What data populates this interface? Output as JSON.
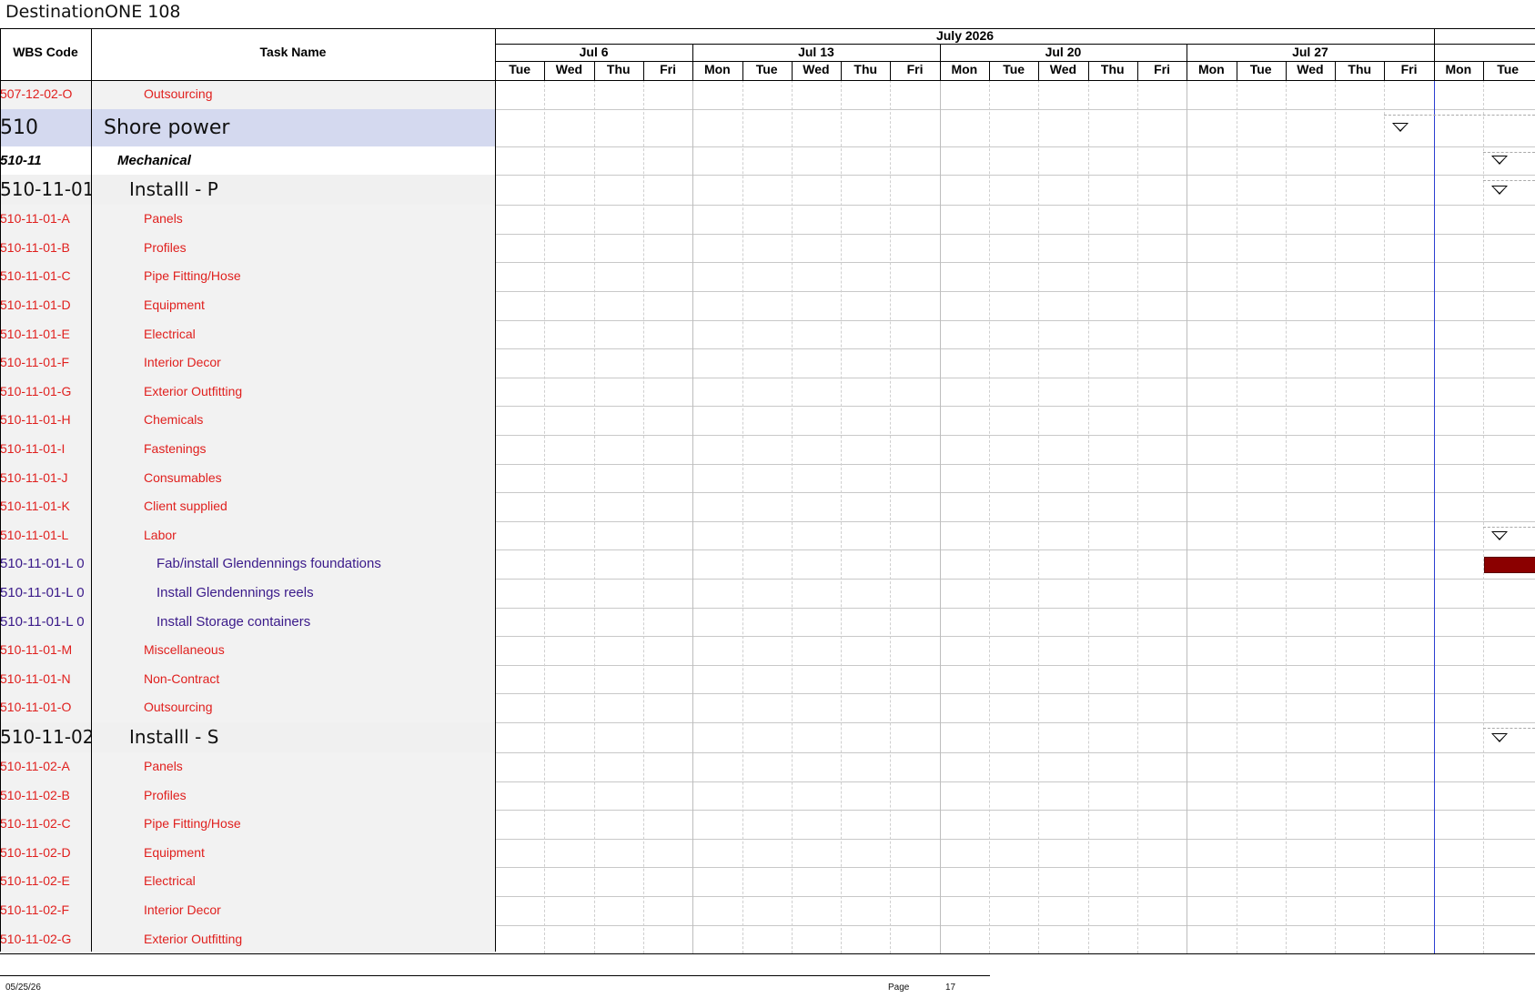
{
  "document": {
    "title": "DestinationONE 108"
  },
  "columns": {
    "wbs_header": "WBS Code",
    "task_header": "Task Name"
  },
  "timeline": {
    "month": "July 2026",
    "weeks": [
      "Jul 6",
      "Jul 13",
      "Jul 20",
      "Jul 27"
    ],
    "days": [
      "Tue",
      "Wed",
      "Thu",
      "Fri",
      "Mon",
      "Tue",
      "Wed",
      "Thu",
      "Fri",
      "Mon",
      "Tue",
      "Wed",
      "Thu",
      "Fri",
      "Mon",
      "Tue",
      "Wed",
      "Thu",
      "Fri",
      "Mon",
      "Tue"
    ]
  },
  "rows": [
    {
      "wbs": "507-12-02-O",
      "name": "Outsourcing",
      "style": "leaf"
    },
    {
      "wbs": "510",
      "name": "Shore power",
      "style": "level1",
      "summary_marker_day": 18
    },
    {
      "wbs": "510-11",
      "name": "Mechanical",
      "style": "level2",
      "summary_marker_day": 20
    },
    {
      "wbs": "510-11-01",
      "name": "Installl - P",
      "style": "level3",
      "summary_marker_day": 20
    },
    {
      "wbs": "510-11-01-A",
      "name": "Panels",
      "style": "leaf"
    },
    {
      "wbs": "510-11-01-B",
      "name": "Profiles",
      "style": "leaf"
    },
    {
      "wbs": "510-11-01-C",
      "name": "Pipe Fitting/Hose",
      "style": "leaf"
    },
    {
      "wbs": "510-11-01-D",
      "name": "Equipment",
      "style": "leaf"
    },
    {
      "wbs": "510-11-01-E",
      "name": "Electrical",
      "style": "leaf"
    },
    {
      "wbs": "510-11-01-F",
      "name": "Interior Decor",
      "style": "leaf"
    },
    {
      "wbs": "510-11-01-G",
      "name": "Exterior Outfitting",
      "style": "leaf"
    },
    {
      "wbs": "510-11-01-H",
      "name": "Chemicals",
      "style": "leaf"
    },
    {
      "wbs": "510-11-01-I",
      "name": "Fastenings",
      "style": "leaf"
    },
    {
      "wbs": "510-11-01-J",
      "name": "Consumables",
      "style": "leaf"
    },
    {
      "wbs": "510-11-01-K",
      "name": "Client supplied",
      "style": "leaf"
    },
    {
      "wbs": "510-11-01-L",
      "name": "Labor",
      "style": "leaf",
      "summary_marker_day": 20
    },
    {
      "wbs": "510-11-01-L 0",
      "name": "Fab/install Glendennings foundations",
      "style": "task",
      "bar_start_day": 20
    },
    {
      "wbs": "510-11-01-L 0",
      "name": "Install Glendennings reels",
      "style": "task"
    },
    {
      "wbs": "510-11-01-L 0",
      "name": "Install Storage containers",
      "style": "task"
    },
    {
      "wbs": "510-11-01-M",
      "name": "Miscellaneous",
      "style": "leaf"
    },
    {
      "wbs": "510-11-01-N",
      "name": "Non-Contract",
      "style": "leaf"
    },
    {
      "wbs": "510-11-01-O",
      "name": "Outsourcing",
      "style": "leaf"
    },
    {
      "wbs": "510-11-02",
      "name": "Installl - S",
      "style": "level3",
      "summary_marker_day": 20
    },
    {
      "wbs": "510-11-02-A",
      "name": "Panels",
      "style": "leaf"
    },
    {
      "wbs": "510-11-02-B",
      "name": "Profiles",
      "style": "leaf"
    },
    {
      "wbs": "510-11-02-C",
      "name": "Pipe Fitting/Hose",
      "style": "leaf"
    },
    {
      "wbs": "510-11-02-D",
      "name": "Equipment",
      "style": "leaf"
    },
    {
      "wbs": "510-11-02-E",
      "name": "Electrical",
      "style": "leaf"
    },
    {
      "wbs": "510-11-02-F",
      "name": "Interior Decor",
      "style": "leaf"
    },
    {
      "wbs": "510-11-02-G",
      "name": "Exterior Outfitting",
      "style": "leaf"
    }
  ],
  "footer": {
    "date": "05/25/26",
    "page_label": "Page",
    "page_number": "17"
  },
  "colors": {
    "leaf_text": "#e0201e",
    "task_text": "#3a1a8a",
    "level1_bg": "#d4d9ef",
    "level3_bg": "#f0f0f0",
    "bar": "#8b0000",
    "today_line": "#2b3fd1"
  }
}
